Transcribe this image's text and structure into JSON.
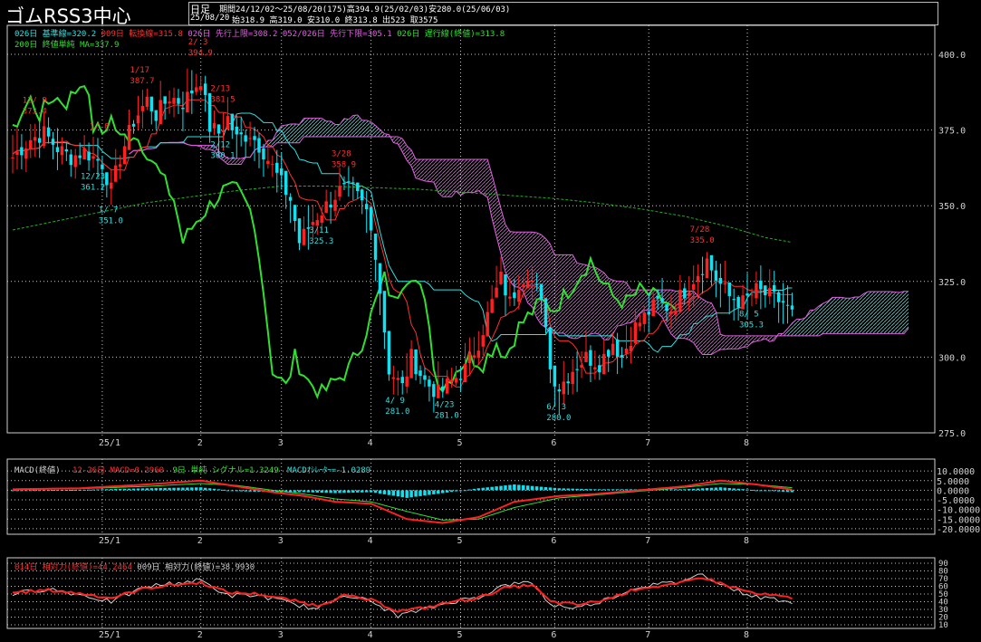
{
  "header": {
    "title": "ゴムRSS3中心",
    "period_label": "日足",
    "period_info": "期間24/12/02～25/08/20(175)高394.9(25/02/03)安280.0(25/06/03)",
    "date": "25/08/20",
    "ohlc": "始318.9 高319.0 安310.0 終313.8 出523 取3575"
  },
  "indicators": {
    "line1": [
      {
        "text": "026日 基準線=320.2",
        "color": "#2ee0e0"
      },
      {
        "text": "009日 転換線=315.8",
        "color": "#ff3030"
      },
      {
        "text": "026日 先行上限=308.2",
        "color": "#e060e0"
      },
      {
        "text": "052/026日 先行下限=305.1",
        "color": "#e060e0"
      },
      {
        "text": "026日 遅行線(終値)=313.8",
        "color": "#30e030"
      }
    ],
    "line2": [
      {
        "text": "200日 終値単純 MA=337.9",
        "color": "#30e030"
      }
    ]
  },
  "macd_header": [
    {
      "text": "MACD(終値)",
      "color": "#d0d0d0"
    },
    {
      "text": "12-26日 MACD=0.2960",
      "color": "#ff3030"
    },
    {
      "text": "9日 単純 シグナル=1.3249",
      "color": "#30e030"
    },
    {
      "text": "MACDｵｼﾚｰﾀｰ=-1.0289",
      "color": "#2ee0e0"
    }
  ],
  "rsi_header": [
    {
      "text": "014日 相対力(終値)=44.2464",
      "color": "#ff3030"
    },
    {
      "text": "009日 相対力(終値)=38.9930",
      "color": "#d0d0d0"
    }
  ],
  "colors": {
    "up": "#ff2020",
    "down": "#10e0f0",
    "kijun": "#2ee0e0",
    "tenkan": "#ff3030",
    "senkou": "#e060e0",
    "chikou": "#30e030",
    "ma200": "#20b020",
    "grid": "#c8c8c8",
    "axis": "#d0d0d0",
    "text": "#d0d0d0"
  },
  "chart_data": [
    {
      "type": "candlestick",
      "ylim": [
        275,
        400
      ],
      "yticks": [
        275,
        300,
        325,
        350,
        375,
        400
      ],
      "ytick_labels": [
        "275.0",
        "300.0",
        "325.0",
        "350.0",
        "375.0",
        "400.0"
      ],
      "xticks": [
        {
          "label": "25/1",
          "day": 20
        },
        {
          "label": "2",
          "day": 42
        },
        {
          "label": "3",
          "day": 60
        },
        {
          "label": "4",
          "day": 80
        },
        {
          "label": "5",
          "day": 100
        },
        {
          "label": "6",
          "day": 121
        },
        {
          "label": "7",
          "day": 142
        },
        {
          "label": "8",
          "day": 164
        }
      ],
      "days": 175,
      "projection_days": 26,
      "close_keypoints": [
        [
          0,
          366
        ],
        [
          4,
          372
        ],
        [
          7,
          374
        ],
        [
          10,
          369
        ],
        [
          13,
          366
        ],
        [
          16,
          368
        ],
        [
          20,
          364
        ],
        [
          22,
          355
        ],
        [
          24,
          366
        ],
        [
          27,
          378
        ],
        [
          30,
          385
        ],
        [
          32,
          380
        ],
        [
          35,
          386
        ],
        [
          38,
          384
        ],
        [
          40,
          388
        ],
        [
          42,
          392
        ],
        [
          44,
          376
        ],
        [
          46,
          374
        ],
        [
          48,
          379
        ],
        [
          50,
          372
        ],
        [
          53,
          374
        ],
        [
          56,
          368
        ],
        [
          59,
          360
        ],
        [
          62,
          352
        ],
        [
          64,
          338
        ],
        [
          67,
          345
        ],
        [
          70,
          350
        ],
        [
          73,
          355
        ],
        [
          76,
          355
        ],
        [
          79,
          348
        ],
        [
          81,
          335
        ],
        [
          82,
          322
        ],
        [
          84,
          296
        ],
        [
          87,
          290
        ],
        [
          89,
          300
        ],
        [
          92,
          292
        ],
        [
          95,
          288
        ],
        [
          98,
          292
        ],
        [
          101,
          296
        ],
        [
          104,
          305
        ],
        [
          107,
          318
        ],
        [
          109,
          326
        ],
        [
          111,
          318
        ],
        [
          113,
          325
        ],
        [
          115,
          328
        ],
        [
          117,
          322
        ],
        [
          119,
          312
        ],
        [
          120,
          296
        ],
        [
          122,
          290
        ],
        [
          125,
          296
        ],
        [
          128,
          300
        ],
        [
          131,
          298
        ],
        [
          134,
          305
        ],
        [
          136,
          300
        ],
        [
          139,
          310
        ],
        [
          142,
          315
        ],
        [
          144,
          318
        ],
        [
          147,
          316
        ],
        [
          150,
          322
        ],
        [
          153,
          328
        ],
        [
          155,
          332
        ],
        [
          157,
          326
        ],
        [
          160,
          320
        ],
        [
          163,
          318
        ],
        [
          166,
          322
        ],
        [
          169,
          320
        ],
        [
          172,
          318
        ],
        [
          174,
          314
        ]
      ],
      "ma200_keypoints": [
        [
          0,
          342
        ],
        [
          10,
          345
        ],
        [
          20,
          348
        ],
        [
          30,
          351
        ],
        [
          40,
          353
        ],
        [
          50,
          355
        ],
        [
          60,
          356.5
        ],
        [
          70,
          356.5
        ],
        [
          80,
          356
        ],
        [
          90,
          355.5
        ],
        [
          100,
          354.5
        ],
        [
          110,
          353.5
        ],
        [
          120,
          352.5
        ],
        [
          130,
          351
        ],
        [
          140,
          349
        ],
        [
          150,
          346.5
        ],
        [
          160,
          343
        ],
        [
          168,
          339.5
        ],
        [
          174,
          337.9
        ]
      ],
      "annotations": [
        {
          "day": 5,
          "lines": [
            "12/ 9",
            "373.4"
          ],
          "kind": "high"
        },
        {
          "day": 18,
          "lines": [
            "12/23",
            "361.2"
          ],
          "kind": "low"
        },
        {
          "day": 20,
          "lines": [
            "1/ 8",
            ""
          ],
          "kind": "high"
        },
        {
          "day": 22,
          "lines": [
            "1/ 7",
            "351.0"
          ],
          "kind": "low"
        },
        {
          "day": 29,
          "lines": [
            "1/17",
            "387.7"
          ],
          "kind": "high"
        },
        {
          "day": 42,
          "lines": [
            "2/ 3",
            "394.9"
          ],
          "kind": "high"
        },
        {
          "day": 47,
          "lines": [
            "2/13",
            "381.5"
          ],
          "kind": "high"
        },
        {
          "day": 47,
          "lines": [
            "2/12",
            "360.1"
          ],
          "kind": "low"
        },
        {
          "day": 69,
          "lines": [
            "3/11",
            "325.3"
          ],
          "kind": "low"
        },
        {
          "day": 74,
          "lines": [
            "3/28",
            "358.9"
          ],
          "kind": "high"
        },
        {
          "day": 86,
          "lines": [
            "4/ 9",
            "281.0"
          ],
          "kind": "low"
        },
        {
          "day": 97,
          "lines": [
            "4/23",
            "281.0"
          ],
          "kind": "low"
        },
        {
          "day": 122,
          "lines": [
            "6/ 3",
            "280.0"
          ],
          "kind": "low"
        },
        {
          "day": 154,
          "lines": [
            "7/28",
            "335.0"
          ],
          "kind": "high"
        },
        {
          "day": 165,
          "lines": [
            "8/ 5",
            "305.3"
          ],
          "kind": "low"
        }
      ]
    },
    {
      "type": "line",
      "name": "MACD",
      "ylim": [
        -21,
        11
      ],
      "yticks": [
        10,
        5,
        0,
        -5,
        -10,
        -15,
        -20
      ],
      "ytick_labels": [
        "10.0000",
        "5.0000",
        "0.0000",
        "-5.0000",
        "-10.0000",
        "-15.0000",
        "-20.0000"
      ],
      "macd_keypoints": [
        [
          0,
          0.5
        ],
        [
          15,
          1
        ],
        [
          30,
          3
        ],
        [
          42,
          5
        ],
        [
          50,
          2
        ],
        [
          58,
          -1
        ],
        [
          65,
          -3
        ],
        [
          72,
          -6
        ],
        [
          80,
          -7
        ],
        [
          88,
          -15
        ],
        [
          96,
          -17
        ],
        [
          104,
          -14
        ],
        [
          112,
          -6
        ],
        [
          122,
          -3
        ],
        [
          130,
          -2
        ],
        [
          140,
          0
        ],
        [
          150,
          2
        ],
        [
          158,
          5
        ],
        [
          166,
          3
        ],
        [
          174,
          0.3
        ]
      ],
      "signal_keypoints": [
        [
          0,
          0.5
        ],
        [
          15,
          0.8
        ],
        [
          30,
          2
        ],
        [
          42,
          3.5
        ],
        [
          50,
          2.5
        ],
        [
          58,
          0
        ],
        [
          65,
          -2
        ],
        [
          72,
          -4.5
        ],
        [
          80,
          -6
        ],
        [
          88,
          -11
        ],
        [
          96,
          -15.5
        ],
        [
          104,
          -15
        ],
        [
          112,
          -9
        ],
        [
          122,
          -4
        ],
        [
          130,
          -2.5
        ],
        [
          140,
          -0.5
        ],
        [
          150,
          1.5
        ],
        [
          158,
          3.5
        ],
        [
          166,
          3
        ],
        [
          174,
          1.3
        ]
      ]
    },
    {
      "type": "line",
      "name": "RSI",
      "ylim": [
        10,
        90
      ],
      "yticks": [
        90,
        80,
        70,
        60,
        50,
        40,
        30,
        20,
        10
      ],
      "ytick_labels": [
        "90",
        "80",
        "70",
        "60",
        "50",
        "40",
        "30",
        "20",
        "10"
      ],
      "rsi14_keypoints": [
        [
          0,
          52
        ],
        [
          8,
          55
        ],
        [
          16,
          50
        ],
        [
          22,
          45
        ],
        [
          30,
          58
        ],
        [
          36,
          62
        ],
        [
          42,
          65
        ],
        [
          48,
          52
        ],
        [
          55,
          50
        ],
        [
          62,
          42
        ],
        [
          68,
          35
        ],
        [
          74,
          48
        ],
        [
          80,
          42
        ],
        [
          86,
          28
        ],
        [
          92,
          32
        ],
        [
          98,
          40
        ],
        [
          104,
          45
        ],
        [
          110,
          58
        ],
        [
          116,
          62
        ],
        [
          120,
          40
        ],
        [
          126,
          36
        ],
        [
          132,
          42
        ],
        [
          140,
          58
        ],
        [
          148,
          62
        ],
        [
          154,
          72
        ],
        [
          160,
          60
        ],
        [
          166,
          50
        ],
        [
          170,
          48
        ],
        [
          174,
          44
        ]
      ],
      "rsi9_keypoints": [
        [
          0,
          50
        ],
        [
          8,
          57
        ],
        [
          16,
          48
        ],
        [
          22,
          40
        ],
        [
          30,
          60
        ],
        [
          36,
          64
        ],
        [
          42,
          68
        ],
        [
          48,
          48
        ],
        [
          55,
          48
        ],
        [
          62,
          38
        ],
        [
          68,
          30
        ],
        [
          74,
          50
        ],
        [
          80,
          40
        ],
        [
          86,
          22
        ],
        [
          92,
          30
        ],
        [
          98,
          40
        ],
        [
          104,
          46
        ],
        [
          110,
          62
        ],
        [
          116,
          65
        ],
        [
          120,
          36
        ],
        [
          126,
          32
        ],
        [
          132,
          42
        ],
        [
          140,
          60
        ],
        [
          148,
          65
        ],
        [
          154,
          76
        ],
        [
          160,
          58
        ],
        [
          166,
          46
        ],
        [
          170,
          44
        ],
        [
          174,
          39
        ]
      ]
    }
  ]
}
